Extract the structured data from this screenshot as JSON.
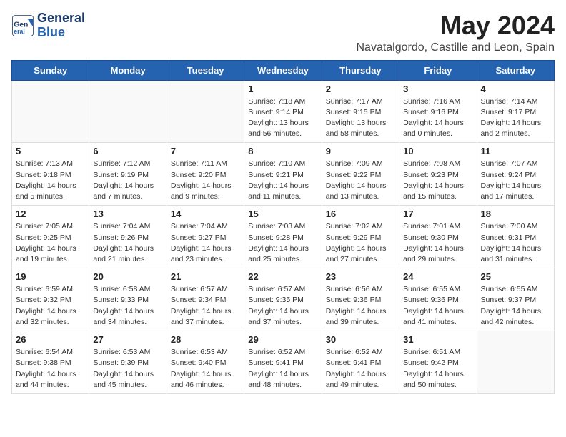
{
  "header": {
    "logo_line1": "General",
    "logo_line2": "Blue",
    "month_title": "May 2024",
    "location": "Navatalgordo, Castille and Leon, Spain"
  },
  "weekdays": [
    "Sunday",
    "Monday",
    "Tuesday",
    "Wednesday",
    "Thursday",
    "Friday",
    "Saturday"
  ],
  "weeks": [
    [
      {
        "day": "",
        "info": ""
      },
      {
        "day": "",
        "info": ""
      },
      {
        "day": "",
        "info": ""
      },
      {
        "day": "1",
        "info": "Sunrise: 7:18 AM\nSunset: 9:14 PM\nDaylight: 13 hours\nand 56 minutes."
      },
      {
        "day": "2",
        "info": "Sunrise: 7:17 AM\nSunset: 9:15 PM\nDaylight: 13 hours\nand 58 minutes."
      },
      {
        "day": "3",
        "info": "Sunrise: 7:16 AM\nSunset: 9:16 PM\nDaylight: 14 hours\nand 0 minutes."
      },
      {
        "day": "4",
        "info": "Sunrise: 7:14 AM\nSunset: 9:17 PM\nDaylight: 14 hours\nand 2 minutes."
      }
    ],
    [
      {
        "day": "5",
        "info": "Sunrise: 7:13 AM\nSunset: 9:18 PM\nDaylight: 14 hours\nand 5 minutes."
      },
      {
        "day": "6",
        "info": "Sunrise: 7:12 AM\nSunset: 9:19 PM\nDaylight: 14 hours\nand 7 minutes."
      },
      {
        "day": "7",
        "info": "Sunrise: 7:11 AM\nSunset: 9:20 PM\nDaylight: 14 hours\nand 9 minutes."
      },
      {
        "day": "8",
        "info": "Sunrise: 7:10 AM\nSunset: 9:21 PM\nDaylight: 14 hours\nand 11 minutes."
      },
      {
        "day": "9",
        "info": "Sunrise: 7:09 AM\nSunset: 9:22 PM\nDaylight: 14 hours\nand 13 minutes."
      },
      {
        "day": "10",
        "info": "Sunrise: 7:08 AM\nSunset: 9:23 PM\nDaylight: 14 hours\nand 15 minutes."
      },
      {
        "day": "11",
        "info": "Sunrise: 7:07 AM\nSunset: 9:24 PM\nDaylight: 14 hours\nand 17 minutes."
      }
    ],
    [
      {
        "day": "12",
        "info": "Sunrise: 7:05 AM\nSunset: 9:25 PM\nDaylight: 14 hours\nand 19 minutes."
      },
      {
        "day": "13",
        "info": "Sunrise: 7:04 AM\nSunset: 9:26 PM\nDaylight: 14 hours\nand 21 minutes."
      },
      {
        "day": "14",
        "info": "Sunrise: 7:04 AM\nSunset: 9:27 PM\nDaylight: 14 hours\nand 23 minutes."
      },
      {
        "day": "15",
        "info": "Sunrise: 7:03 AM\nSunset: 9:28 PM\nDaylight: 14 hours\nand 25 minutes."
      },
      {
        "day": "16",
        "info": "Sunrise: 7:02 AM\nSunset: 9:29 PM\nDaylight: 14 hours\nand 27 minutes."
      },
      {
        "day": "17",
        "info": "Sunrise: 7:01 AM\nSunset: 9:30 PM\nDaylight: 14 hours\nand 29 minutes."
      },
      {
        "day": "18",
        "info": "Sunrise: 7:00 AM\nSunset: 9:31 PM\nDaylight: 14 hours\nand 31 minutes."
      }
    ],
    [
      {
        "day": "19",
        "info": "Sunrise: 6:59 AM\nSunset: 9:32 PM\nDaylight: 14 hours\nand 32 minutes."
      },
      {
        "day": "20",
        "info": "Sunrise: 6:58 AM\nSunset: 9:33 PM\nDaylight: 14 hours\nand 34 minutes."
      },
      {
        "day": "21",
        "info": "Sunrise: 6:57 AM\nSunset: 9:34 PM\nDaylight: 14 hours\nand 37 minutes."
      },
      {
        "day": "22",
        "info": "Sunrise: 6:57 AM\nSunset: 9:35 PM\nDaylight: 14 hours\nand 37 minutes."
      },
      {
        "day": "23",
        "info": "Sunrise: 6:56 AM\nSunset: 9:36 PM\nDaylight: 14 hours\nand 39 minutes."
      },
      {
        "day": "24",
        "info": "Sunrise: 6:55 AM\nSunset: 9:36 PM\nDaylight: 14 hours\nand 41 minutes."
      },
      {
        "day": "25",
        "info": "Sunrise: 6:55 AM\nSunset: 9:37 PM\nDaylight: 14 hours\nand 42 minutes."
      }
    ],
    [
      {
        "day": "26",
        "info": "Sunrise: 6:54 AM\nSunset: 9:38 PM\nDaylight: 14 hours\nand 44 minutes."
      },
      {
        "day": "27",
        "info": "Sunrise: 6:53 AM\nSunset: 9:39 PM\nDaylight: 14 hours\nand 45 minutes."
      },
      {
        "day": "28",
        "info": "Sunrise: 6:53 AM\nSunset: 9:40 PM\nDaylight: 14 hours\nand 46 minutes."
      },
      {
        "day": "29",
        "info": "Sunrise: 6:52 AM\nSunset: 9:41 PM\nDaylight: 14 hours\nand 48 minutes."
      },
      {
        "day": "30",
        "info": "Sunrise: 6:52 AM\nSunset: 9:41 PM\nDaylight: 14 hours\nand 49 minutes."
      },
      {
        "day": "31",
        "info": "Sunrise: 6:51 AM\nSunset: 9:42 PM\nDaylight: 14 hours\nand 50 minutes."
      },
      {
        "day": "",
        "info": ""
      }
    ]
  ]
}
